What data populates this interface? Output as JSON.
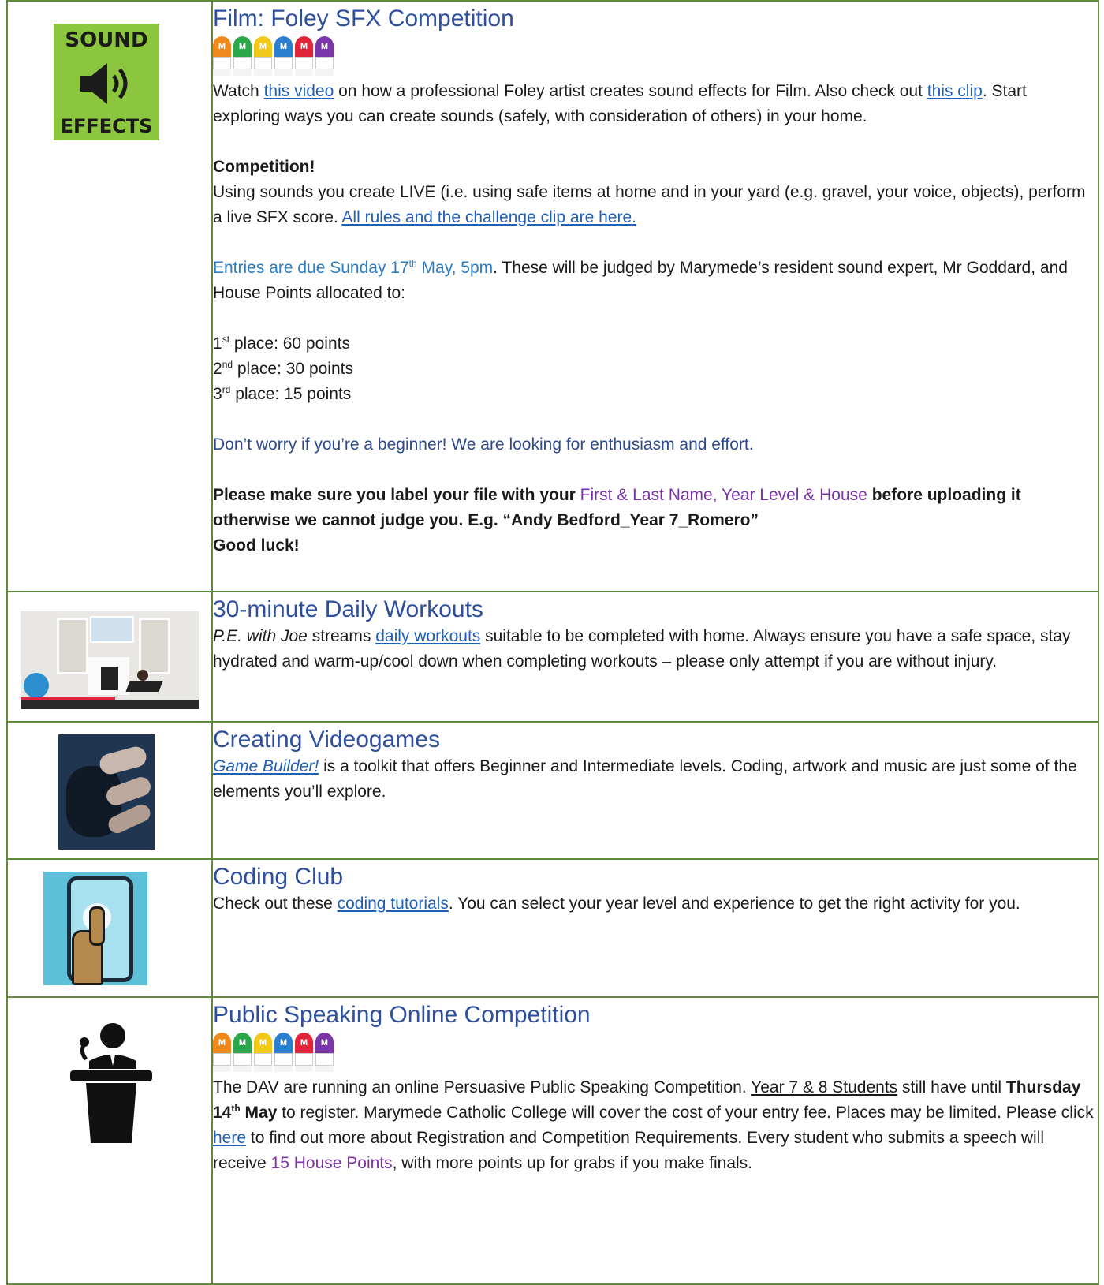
{
  "rows": {
    "foley": {
      "title": "Film: Foley SFX Competition",
      "image_text_top": "SOUND",
      "image_text_bottom": "EFFECTS",
      "p1_a": "Watch ",
      "p1_link1": "this video",
      "p1_b": " on how a professional Foley artist creates sound effects for Film. Also check out ",
      "p1_link2": "this clip",
      "p1_c": ". Start exploring ways you can create sounds (safely, with consideration of others) in your home.",
      "comp_heading": "Competition!",
      "p2_a": "Using sounds you create LIVE (i.e. using safe items at home and in your yard (e.g. gravel, your voice, objects), perform a live SFX score. ",
      "p2_link": "All rules and the challenge clip are here.",
      "p3_a": "Entries are due Sunday 17",
      "p3_sup": "th",
      "p3_b": " May, 5pm",
      "p3_c": ". These will be judged by Marymede’s resident sound expert, Mr Goddard, and House Points allocated to:",
      "place1_num": "1",
      "place1_sup": "st",
      "place1_text": " place: 60 points",
      "place2_num": "2",
      "place2_sup": "nd",
      "place2_text": " place: 30 points",
      "place3_num": "3",
      "place3_sup": "rd",
      "place3_text": " place: 15 points",
      "p4": "Don’t worry if you’re a beginner! We are looking for enthusiasm and effort.",
      "p5_a": "Please make sure you label your file with your ",
      "p5_purple": "First & Last Name, Year Level & House",
      "p5_b": " before uploading it otherwise we cannot judge you. E.g. “Andy Bedford_Year 7_Romero”",
      "p5_c": "Good luck!"
    },
    "workouts": {
      "title": "30-minute Daily Workouts",
      "p_ital": "P.E. with Joe",
      "p_a": " streams ",
      "p_link": "daily workouts",
      "p_b": " suitable to be completed with home. Always ensure you have a safe space, stay hydrated and warm-up/cool down when completing workouts – please only attempt if you are without injury."
    },
    "videogames": {
      "title": "Creating Videogames",
      "p_link": "Game Builder!",
      "p_a": " is a toolkit that offers Beginner and Intermediate levels. Coding, artwork and music are just some of the elements you’ll explore."
    },
    "coding": {
      "title": "Coding Club",
      "p_a": "Check out these ",
      "p_link": "coding tutorials",
      "p_b": ". You can select your year level and experience to get the right activity for you."
    },
    "speaking": {
      "title": "Public Speaking Online Competition",
      "p_a": "The DAV are running an online Persuasive Public Speaking Competition. ",
      "p_under": "Year 7 & 8 Students",
      "p_b": " still have until ",
      "p_bold": "Thursday 14",
      "p_bold_sup": "th",
      "p_bold2": " May",
      "p_c": " to register. Marymede Catholic College will cover the cost of your entry fee. Places may be limited. Please click ",
      "p_link": "here",
      "p_d": " to find out more about Registration and Competition Requirements. Every student who submits a speech will receive ",
      "p_purple": "15 House Points",
      "p_e": ", with more points up for grabs if you make finals."
    }
  },
  "houses": [
    {
      "color": "#f08a1c"
    },
    {
      "color": "#2aa84a"
    },
    {
      "color": "#f2c81a"
    },
    {
      "color": "#2a7fd0"
    },
    {
      "color": "#e0243a"
    },
    {
      "color": "#7a35a8"
    }
  ],
  "house_letter": "M"
}
